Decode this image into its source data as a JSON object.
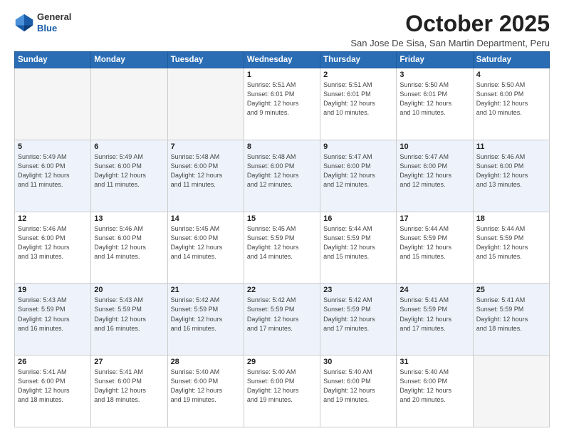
{
  "logo": {
    "line1": "General",
    "line2": "Blue"
  },
  "title": "October 2025",
  "location": "San Jose De Sisa, San Martin Department, Peru",
  "days_of_week": [
    "Sunday",
    "Monday",
    "Tuesday",
    "Wednesday",
    "Thursday",
    "Friday",
    "Saturday"
  ],
  "weeks": [
    [
      {
        "day": "",
        "info": ""
      },
      {
        "day": "",
        "info": ""
      },
      {
        "day": "",
        "info": ""
      },
      {
        "day": "1",
        "info": "Sunrise: 5:51 AM\nSunset: 6:01 PM\nDaylight: 12 hours\nand 9 minutes."
      },
      {
        "day": "2",
        "info": "Sunrise: 5:51 AM\nSunset: 6:01 PM\nDaylight: 12 hours\nand 10 minutes."
      },
      {
        "day": "3",
        "info": "Sunrise: 5:50 AM\nSunset: 6:01 PM\nDaylight: 12 hours\nand 10 minutes."
      },
      {
        "day": "4",
        "info": "Sunrise: 5:50 AM\nSunset: 6:00 PM\nDaylight: 12 hours\nand 10 minutes."
      }
    ],
    [
      {
        "day": "5",
        "info": "Sunrise: 5:49 AM\nSunset: 6:00 PM\nDaylight: 12 hours\nand 11 minutes."
      },
      {
        "day": "6",
        "info": "Sunrise: 5:49 AM\nSunset: 6:00 PM\nDaylight: 12 hours\nand 11 minutes."
      },
      {
        "day": "7",
        "info": "Sunrise: 5:48 AM\nSunset: 6:00 PM\nDaylight: 12 hours\nand 11 minutes."
      },
      {
        "day": "8",
        "info": "Sunrise: 5:48 AM\nSunset: 6:00 PM\nDaylight: 12 hours\nand 12 minutes."
      },
      {
        "day": "9",
        "info": "Sunrise: 5:47 AM\nSunset: 6:00 PM\nDaylight: 12 hours\nand 12 minutes."
      },
      {
        "day": "10",
        "info": "Sunrise: 5:47 AM\nSunset: 6:00 PM\nDaylight: 12 hours\nand 12 minutes."
      },
      {
        "day": "11",
        "info": "Sunrise: 5:46 AM\nSunset: 6:00 PM\nDaylight: 12 hours\nand 13 minutes."
      }
    ],
    [
      {
        "day": "12",
        "info": "Sunrise: 5:46 AM\nSunset: 6:00 PM\nDaylight: 12 hours\nand 13 minutes."
      },
      {
        "day": "13",
        "info": "Sunrise: 5:46 AM\nSunset: 6:00 PM\nDaylight: 12 hours\nand 14 minutes."
      },
      {
        "day": "14",
        "info": "Sunrise: 5:45 AM\nSunset: 6:00 PM\nDaylight: 12 hours\nand 14 minutes."
      },
      {
        "day": "15",
        "info": "Sunrise: 5:45 AM\nSunset: 5:59 PM\nDaylight: 12 hours\nand 14 minutes."
      },
      {
        "day": "16",
        "info": "Sunrise: 5:44 AM\nSunset: 5:59 PM\nDaylight: 12 hours\nand 15 minutes."
      },
      {
        "day": "17",
        "info": "Sunrise: 5:44 AM\nSunset: 5:59 PM\nDaylight: 12 hours\nand 15 minutes."
      },
      {
        "day": "18",
        "info": "Sunrise: 5:44 AM\nSunset: 5:59 PM\nDaylight: 12 hours\nand 15 minutes."
      }
    ],
    [
      {
        "day": "19",
        "info": "Sunrise: 5:43 AM\nSunset: 5:59 PM\nDaylight: 12 hours\nand 16 minutes."
      },
      {
        "day": "20",
        "info": "Sunrise: 5:43 AM\nSunset: 5:59 PM\nDaylight: 12 hours\nand 16 minutes."
      },
      {
        "day": "21",
        "info": "Sunrise: 5:42 AM\nSunset: 5:59 PM\nDaylight: 12 hours\nand 16 minutes."
      },
      {
        "day": "22",
        "info": "Sunrise: 5:42 AM\nSunset: 5:59 PM\nDaylight: 12 hours\nand 17 minutes."
      },
      {
        "day": "23",
        "info": "Sunrise: 5:42 AM\nSunset: 5:59 PM\nDaylight: 12 hours\nand 17 minutes."
      },
      {
        "day": "24",
        "info": "Sunrise: 5:41 AM\nSunset: 5:59 PM\nDaylight: 12 hours\nand 17 minutes."
      },
      {
        "day": "25",
        "info": "Sunrise: 5:41 AM\nSunset: 5:59 PM\nDaylight: 12 hours\nand 18 minutes."
      }
    ],
    [
      {
        "day": "26",
        "info": "Sunrise: 5:41 AM\nSunset: 6:00 PM\nDaylight: 12 hours\nand 18 minutes."
      },
      {
        "day": "27",
        "info": "Sunrise: 5:41 AM\nSunset: 6:00 PM\nDaylight: 12 hours\nand 18 minutes."
      },
      {
        "day": "28",
        "info": "Sunrise: 5:40 AM\nSunset: 6:00 PM\nDaylight: 12 hours\nand 19 minutes."
      },
      {
        "day": "29",
        "info": "Sunrise: 5:40 AM\nSunset: 6:00 PM\nDaylight: 12 hours\nand 19 minutes."
      },
      {
        "day": "30",
        "info": "Sunrise: 5:40 AM\nSunset: 6:00 PM\nDaylight: 12 hours\nand 19 minutes."
      },
      {
        "day": "31",
        "info": "Sunrise: 5:40 AM\nSunset: 6:00 PM\nDaylight: 12 hours\nand 20 minutes."
      },
      {
        "day": "",
        "info": ""
      }
    ]
  ]
}
